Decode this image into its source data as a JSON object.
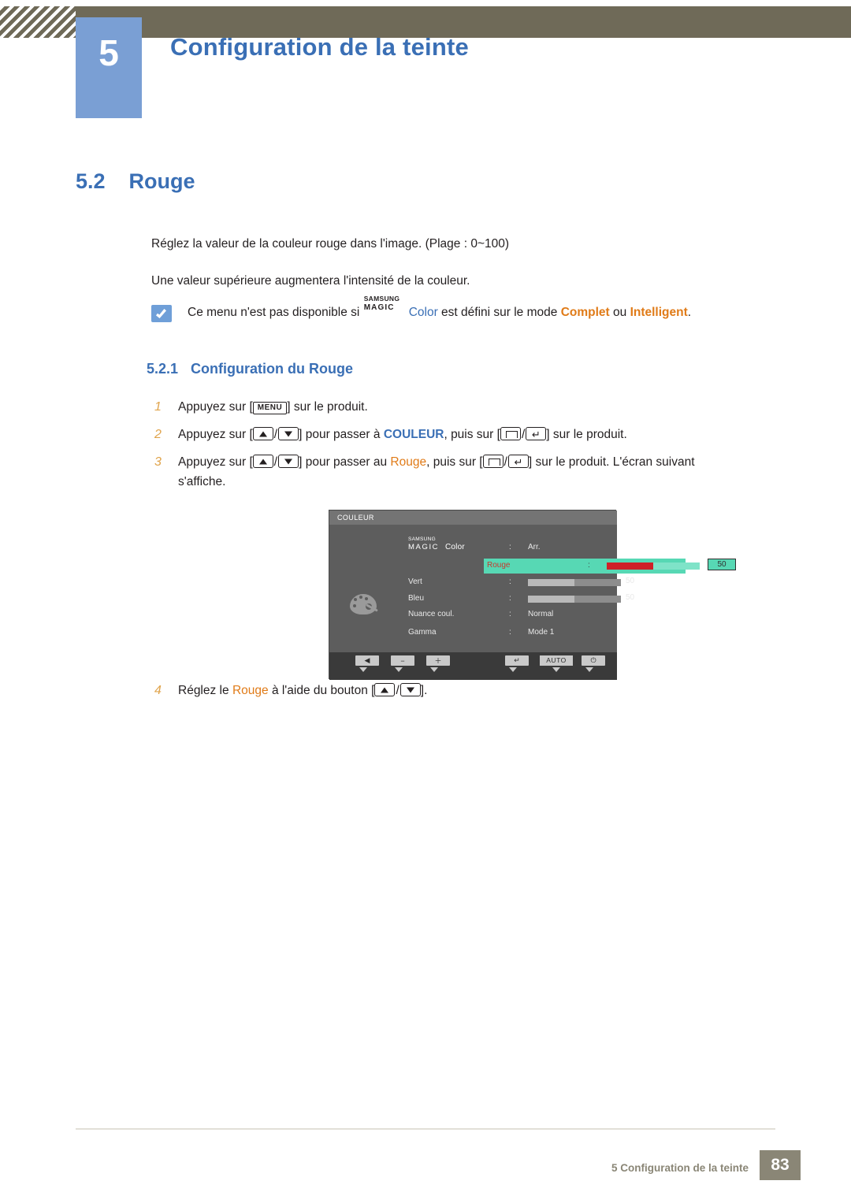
{
  "header": {
    "chapter_number": "5",
    "title": "Configuration de la teinte"
  },
  "section": {
    "number": "5.2",
    "title": "Rouge"
  },
  "paragraphs": {
    "p1": "Réglez la valeur de la couleur rouge dans l'image. (Plage : 0~100)",
    "p2": "Une valeur supérieure augmentera l'intensité de la couleur."
  },
  "note": {
    "icon": "check-note-icon",
    "text_before": "Ce menu n'est pas disponible si",
    "magic_samsung": "SAMSUNG",
    "magic_magic": "MAGIC",
    "magic_color": "Color",
    "text_middle": "est défini sur le mode",
    "mode_1": "Complet",
    "conj": "ou",
    "mode_2": "Intelligent",
    "text_end": "."
  },
  "subsection": {
    "number": "5.2.1",
    "title": "Configuration du Rouge"
  },
  "steps": [
    {
      "index": "1",
      "text_a": "Appuyez sur [",
      "key": "MENU",
      "text_b": "] sur le produit."
    },
    {
      "index": "2",
      "text_a": "Appuyez sur [",
      "text_b": "] pour passer à",
      "target": "COULEUR",
      "text_c": ", puis sur [",
      "text_d": "] sur le produit."
    },
    {
      "index": "3",
      "text_a": "Appuyez sur [",
      "text_b": "] pour passer au",
      "target": "Rouge",
      "text_c": ", puis sur [",
      "text_d": "] sur le produit. L'écran suivant",
      "text_e": "s'affiche."
    },
    {
      "index": "4",
      "text_a": "Réglez le",
      "target": "Rouge",
      "text_b": "à l'aide du bouton [",
      "text_c": "]."
    }
  ],
  "osd": {
    "title": "COULEUR",
    "palette_icon": "palette-icon",
    "rows": [
      {
        "label_samsung": "SAMSUNG",
        "label_magic": "MAGIC",
        "label_color": "Color",
        "colon": ":",
        "value": "Arr."
      },
      {
        "label": "Rouge",
        "colon": ":",
        "value": "50",
        "bar_percent": 50
      },
      {
        "label": "Vert",
        "colon": ":",
        "value": "50",
        "bar_percent": 50
      },
      {
        "label": "Bleu",
        "colon": ":",
        "value": "50",
        "bar_percent": 50
      },
      {
        "label": "Nuance coul.",
        "colon": ":",
        "value": "Normal"
      },
      {
        "label": "Gamma",
        "colon": ":",
        "value": "Mode 1"
      }
    ],
    "footer_buttons": [
      {
        "name": "source-button",
        "glyph": "◀"
      },
      {
        "name": "minus-button",
        "glyph": "−"
      },
      {
        "name": "plus-button",
        "glyph": "＋"
      },
      {
        "name": "enter-button",
        "glyph": "↵"
      },
      {
        "name": "auto-button",
        "glyph": "AUTO"
      },
      {
        "name": "power-button",
        "glyph": "⏻"
      }
    ]
  },
  "footer": {
    "text": "5 Configuration de la teinte",
    "page": "83"
  },
  "colors": {
    "accent_blue": "#3a6fb5",
    "header_bar": "#6f6a58",
    "chapter_box": "#7a9fd4",
    "orange": "#e07b18",
    "osd_highlight": "#57d8b4",
    "osd_red": "#cf2027"
  }
}
